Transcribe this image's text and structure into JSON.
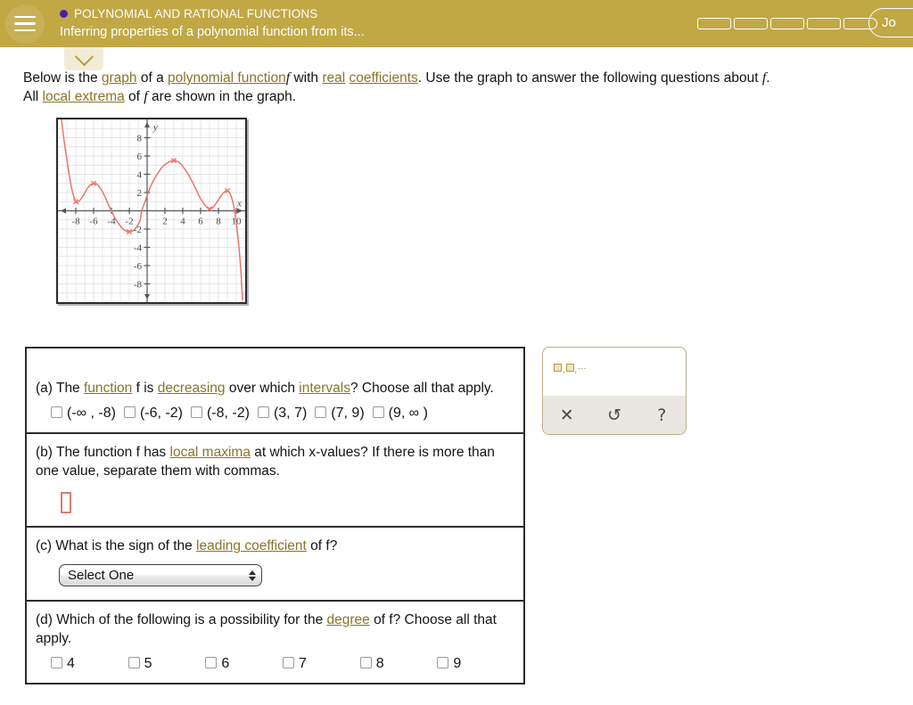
{
  "header": {
    "menu_icon": "hamburger-menu-icon",
    "topic_dot_color": "#4b1fa8",
    "topic": "POLYNOMIAL AND RATIONAL FUNCTIONS",
    "lesson": "Inferring properties of a polynomial function from its...",
    "progress_segments": 5,
    "user_label": "Jo",
    "expand_icon": "chevron-down-icon",
    "bg_color": "#c1a845"
  },
  "prompt": {
    "line1_a": "Below is the ",
    "link_graph": "graph",
    "line1_b": " of a ",
    "link_polyfn": "polynomial function",
    "f1": "f",
    "line1_c": " with ",
    "link_real": "real",
    "line1_d": " ",
    "link_coeff": "coefficients",
    "line1_e": ". Use the graph to answer the following questions about ",
    "f2": "f",
    "line1_f": ".",
    "line2_a": "All ",
    "link_extrema": "local extrema",
    "line2_b": " of ",
    "f3": "f",
    "line2_c": " are shown in the graph."
  },
  "chart_data": {
    "type": "line",
    "title": "",
    "xlabel": "x",
    "ylabel": "y",
    "xlim": [
      -10,
      11
    ],
    "ylim": [
      -10,
      10
    ],
    "xticks": [
      -8,
      -6,
      -4,
      -2,
      2,
      4,
      6,
      8,
      10
    ],
    "yticks": [
      8,
      6,
      4,
      2,
      -2,
      -4,
      -6,
      -8
    ],
    "grid": true,
    "curve_color": "#e8766c",
    "axis_color": "#555555",
    "grid_color": "#dddddd",
    "local_extrema": [
      {
        "x": -8,
        "y": 1.0,
        "kind": "min"
      },
      {
        "x": -6,
        "y": 3.0,
        "kind": "max"
      },
      {
        "x": -2,
        "y": -2.3,
        "kind": "min"
      },
      {
        "x": 3,
        "y": 5.5,
        "kind": "max"
      },
      {
        "x": 7,
        "y": 0.2,
        "kind": "min"
      },
      {
        "x": 9,
        "y": 2.2,
        "kind": "max"
      }
    ],
    "x_intercepts": [
      -4,
      -0.6,
      10
    ],
    "end_behavior": {
      "left": "up",
      "right": "down"
    },
    "series": [
      {
        "name": "f",
        "points": [
          [
            -9.6,
            10.0
          ],
          [
            -9.3,
            7.6
          ],
          [
            -9.0,
            5.6
          ],
          [
            -8.7,
            3.7
          ],
          [
            -8.4,
            2.2
          ],
          [
            -8.0,
            1.0
          ],
          [
            -7.6,
            1.1
          ],
          [
            -7.2,
            1.6
          ],
          [
            -6.8,
            2.3
          ],
          [
            -6.4,
            2.8
          ],
          [
            -6.0,
            3.0
          ],
          [
            -5.6,
            2.9
          ],
          [
            -5.2,
            2.4
          ],
          [
            -4.8,
            1.7
          ],
          [
            -4.4,
            0.8
          ],
          [
            -4.0,
            0.0
          ],
          [
            -3.6,
            -0.8
          ],
          [
            -3.2,
            -1.4
          ],
          [
            -2.8,
            -1.9
          ],
          [
            -2.4,
            -2.2
          ],
          [
            -2.0,
            -2.3
          ],
          [
            -1.6,
            -2.2
          ],
          [
            -1.2,
            -1.8
          ],
          [
            -0.8,
            -1.1
          ],
          [
            -0.6,
            0.0
          ],
          [
            -0.2,
            1.1
          ],
          [
            0.2,
            2.2
          ],
          [
            0.6,
            3.1
          ],
          [
            1.0,
            3.8
          ],
          [
            1.4,
            4.4
          ],
          [
            1.8,
            4.9
          ],
          [
            2.2,
            5.2
          ],
          [
            2.6,
            5.4
          ],
          [
            3.0,
            5.5
          ],
          [
            3.4,
            5.4
          ],
          [
            3.8,
            5.1
          ],
          [
            4.2,
            4.6
          ],
          [
            4.6,
            4.0
          ],
          [
            5.0,
            3.3
          ],
          [
            5.4,
            2.5
          ],
          [
            5.8,
            1.7
          ],
          [
            6.2,
            1.0
          ],
          [
            6.6,
            0.5
          ],
          [
            7.0,
            0.2
          ],
          [
            7.4,
            0.4
          ],
          [
            7.8,
            0.9
          ],
          [
            8.2,
            1.5
          ],
          [
            8.6,
            2.0
          ],
          [
            9.0,
            2.2
          ],
          [
            9.3,
            1.9
          ],
          [
            9.6,
            1.0
          ],
          [
            9.9,
            -0.6
          ],
          [
            10.2,
            -3.0
          ],
          [
            10.5,
            -6.3
          ],
          [
            10.7,
            -9.8
          ]
        ]
      }
    ]
  },
  "questions": [
    {
      "id": "a",
      "text_parts": {
        "p1": "(a) The ",
        "link1": "function",
        "p2": " f is ",
        "link2": "decreasing",
        "p3": " over which ",
        "link3": "intervals",
        "p4": "? Choose all that apply."
      },
      "options": [
        "(-∞ , -8)",
        "(-6, -2)",
        "(-8, -2)",
        "(3, 7)",
        "(7, 9)",
        "(9, ∞ )"
      ]
    },
    {
      "id": "b",
      "text_parts": {
        "p1": "(b) The function f has ",
        "link1": "local maxima",
        "p2": " at which x-values? If there is more than one value, separate them with commas."
      },
      "answer_value": ""
    },
    {
      "id": "c",
      "text_parts": {
        "p1": "(c) What is the sign of the ",
        "link1": "leading coefficient",
        "p2": " of f?"
      },
      "select_value": "Select One"
    },
    {
      "id": "d",
      "text_parts": {
        "p1": "(d) Which of the following is a possibility for the ",
        "link1": "degree",
        "p2": " of f? Choose all that apply."
      },
      "options": [
        "4",
        "5",
        "6",
        "7",
        "8",
        "9"
      ]
    }
  ],
  "keypad": {
    "template_icon": "comma-list-template-icon",
    "template_dots": "...",
    "template_comma": ",",
    "clear_label": "✕",
    "undo_label": "↺",
    "help_label": "?"
  }
}
